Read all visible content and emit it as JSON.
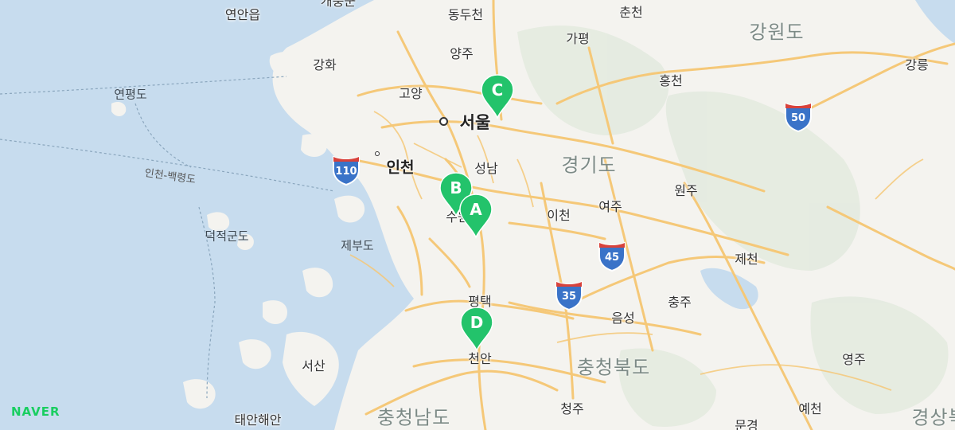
{
  "map": {
    "colors": {
      "water": "#c7dcee",
      "land": "#f4f3ef",
      "road": "#f5c878",
      "pin": "#23c36b",
      "shield": "#3a73c8"
    },
    "cities": {
      "yeonan": "연안읍",
      "gaepung": "개풍군",
      "dongducheon": "동두천",
      "chuncheon": "춘천",
      "gapyeong": "가평",
      "yangju": "양주",
      "ganghwa": "강화",
      "goyang": "고양",
      "hongcheon": "홍천",
      "gangneung": "강릉",
      "seoul": "서울",
      "incheon": "인천",
      "seongnam": "성남",
      "suwon": "수원",
      "icheon": "이천",
      "yeoju": "여주",
      "wonju": "원주",
      "jecheon": "제천",
      "chungju": "충주",
      "pyeongtaek": "평택",
      "eumseong": "음성",
      "cheonan": "천안",
      "seosan": "서산",
      "yeongju": "영주",
      "cheongju": "청주",
      "yecheon": "예천",
      "mungyeong": "문경",
      "taean": "태안해안"
    },
    "regions": {
      "gangwon": "강원도",
      "gyeonggi": "경기도",
      "chungbuk": "충청북도",
      "chungnam": "충청남도",
      "gyeongbuk": "경상북"
    },
    "islands": {
      "yeonpyeong": "연평도",
      "deokjeok": "덕적군도",
      "jebu": "제부도"
    },
    "route": "인천-백령도",
    "shields": [
      "50",
      "110",
      "45",
      "35"
    ],
    "markers": [
      "A",
      "B",
      "C",
      "D"
    ],
    "logo": "NAVER"
  }
}
